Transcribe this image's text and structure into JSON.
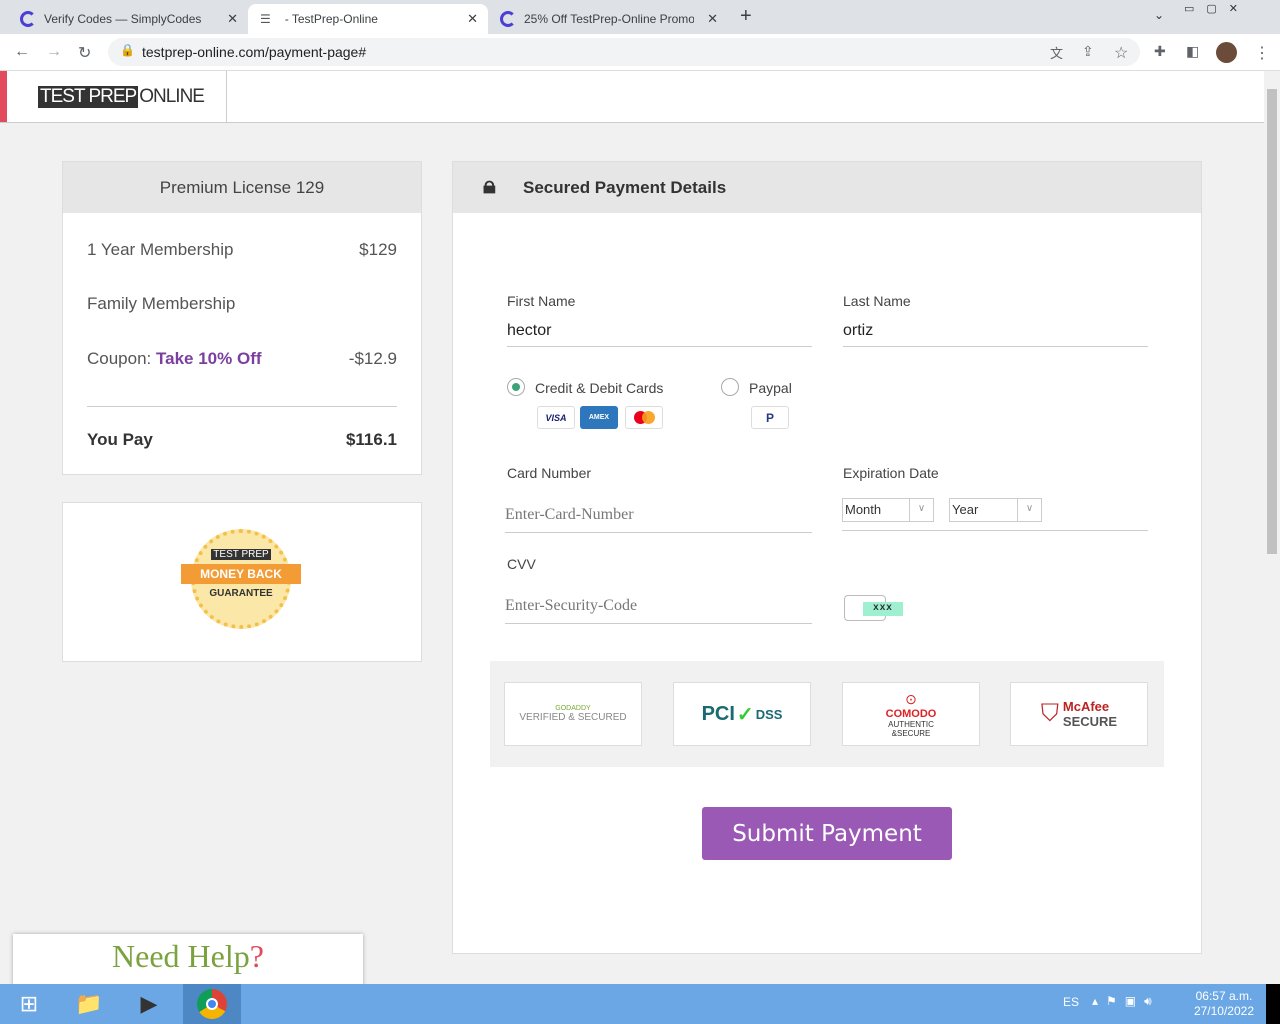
{
  "browser": {
    "tabs": [
      {
        "title": "Verify Codes — SimplyCodes"
      },
      {
        "title": "- TestPrep-Online"
      },
      {
        "title": "25% Off TestPrep-Online Promo C"
      }
    ],
    "url": "testprep-online.com/payment-page#"
  },
  "logo": {
    "part1": "TEST PREP",
    "part2": "ONLINE"
  },
  "summary": {
    "title": "Premium License 129",
    "items": [
      {
        "label": "1 Year Membership",
        "price": "$129"
      },
      {
        "label": "Family Membership",
        "price": ""
      }
    ],
    "coupon_label": "Coupon:",
    "coupon_name": "Take 10% Off",
    "coupon_value": "-$12.9",
    "total_label": "You Pay",
    "total": "$116.1"
  },
  "guarantee": {
    "brand": "TEST PREP",
    "line1": "MONEY BACK",
    "line2": "GUARANTEE"
  },
  "payment": {
    "title": "Secured Payment Details",
    "first_name_label": "First Name",
    "first_name": "hector",
    "last_name_label": "Last Name",
    "last_name": "ortiz",
    "method_cards": "Credit & Debit Cards",
    "method_paypal": "Paypal",
    "card_visa": "VISA",
    "card_amex": "AMEX",
    "card_number_label": "Card Number",
    "card_number_placeholder": "Enter-Card-Number",
    "exp_label": "Expiration Date",
    "month": "Month",
    "year": "Year",
    "cvv_label": "CVV",
    "cvv_placeholder": "Enter-Security-Code",
    "cvv_hint": "xxx",
    "submit": "Submit Payment"
  },
  "trust": [
    {
      "l1": "GODADDY",
      "l2": "VERIFIED & SECURED"
    },
    {
      "l1": "PCI",
      "l2": "DSS"
    },
    {
      "l1": "COMODO",
      "l2": "AUTHENTIC &SECURE"
    },
    {
      "l1": "McAfee",
      "l2": "SECURE"
    }
  ],
  "help": {
    "text": "Need Help",
    "mark": "?"
  },
  "taskbar": {
    "lang": "ES",
    "time": "06:57 a.m.",
    "date": "27/10/2022"
  },
  "colors": {
    "accent": "#9b59b6",
    "brand_red": "#e14b5d"
  }
}
